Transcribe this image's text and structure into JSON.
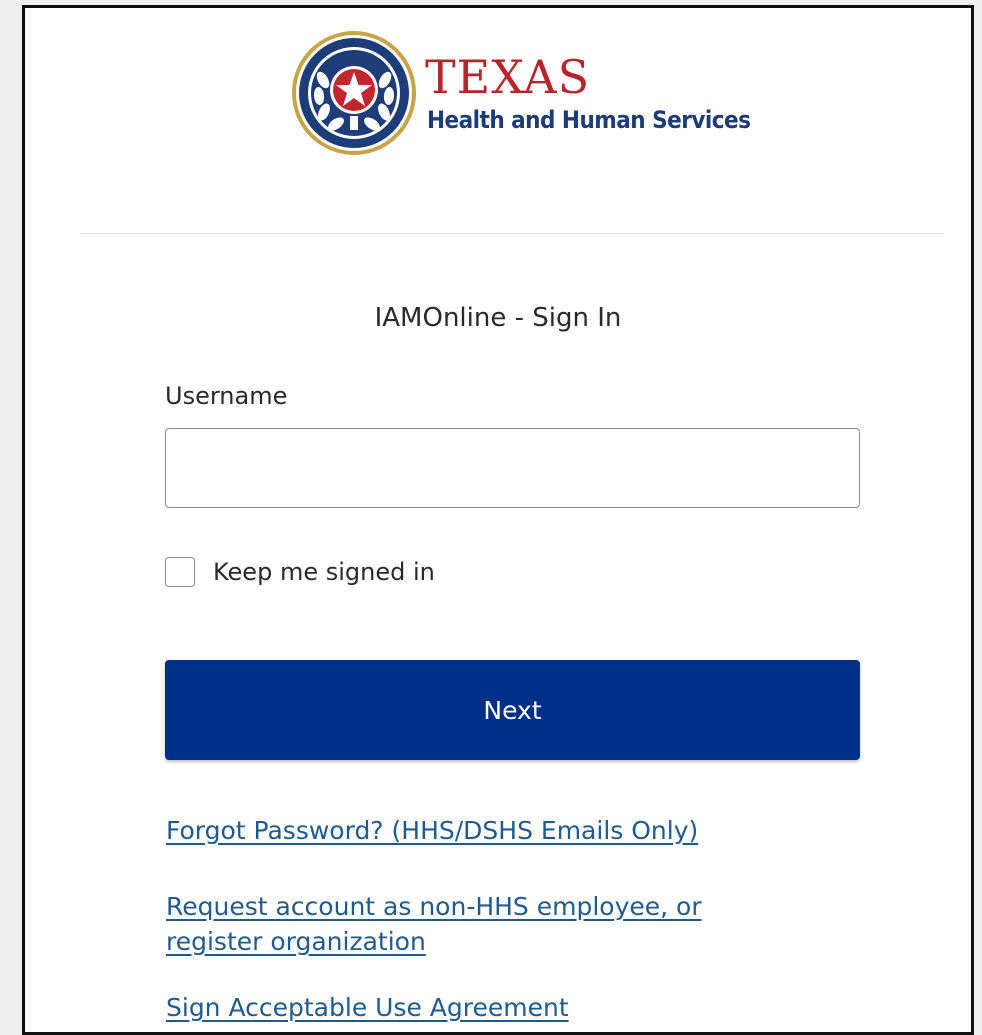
{
  "logo": {
    "top_text": "TEXAS",
    "bottom_text": "Health and Human Services",
    "colors": {
      "red": "#b5262b",
      "blue": "#1d3c78",
      "gold": "#c9a347"
    }
  },
  "form": {
    "title": "IAMOnline - Sign In",
    "username_label": "Username",
    "username_value": "",
    "keep_signed_in_label": "Keep me signed in",
    "keep_signed_in_checked": false,
    "next_label": "Next"
  },
  "links": {
    "forgot_password": "Forgot Password? (HHS/DSHS Emails Only)",
    "request_account_line1": "Request account as non-HHS employee, or",
    "request_account_line2": "register organization",
    "sign_agreement": "Sign Acceptable Use Agreement"
  },
  "colors": {
    "accent": "#002f87",
    "link": "#1f5b8c"
  }
}
